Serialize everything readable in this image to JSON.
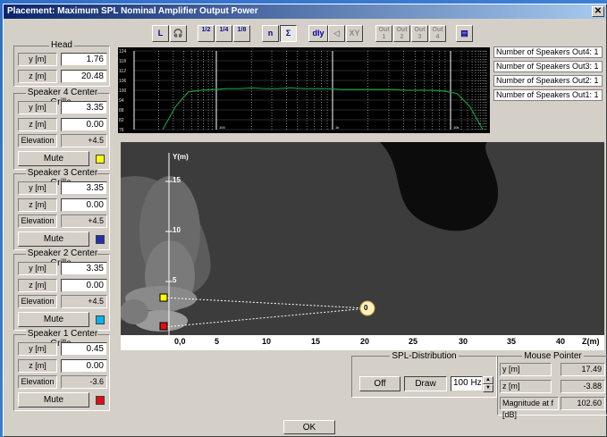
{
  "window": {
    "title": "Placement: Maximum SPL Nominal Amplifier Output Power",
    "close_glyph": "✕"
  },
  "toolbar": {
    "buttons": [
      {
        "label": "L"
      },
      {
        "label": "🎧"
      },
      {
        "label": "1/2"
      },
      {
        "label": "1/4"
      },
      {
        "label": "1/8"
      },
      {
        "label": "n"
      },
      {
        "label": "Σ"
      },
      {
        "label": "dly"
      },
      {
        "label": "◁"
      },
      {
        "label": "XY"
      },
      {
        "label": "Out 1"
      },
      {
        "label": "Out 2"
      },
      {
        "label": "Out 3"
      },
      {
        "label": "Out 4"
      },
      {
        "label": "▤"
      }
    ]
  },
  "head": {
    "title": "Head",
    "y_label": "y [m]",
    "y_value": "1.76",
    "z_label": "z [m]",
    "z_value": "20.48"
  },
  "speakers": [
    {
      "title": "Speaker 4 Center Grille",
      "y_label": "y [m]",
      "y_value": "3.35",
      "z_label": "z [m]",
      "z_value": "0.00",
      "elev_label": "Elevation",
      "elev_value": "+4.5",
      "mute_label": "Mute",
      "color": "#ffff00"
    },
    {
      "title": "Speaker 3 Center Grille",
      "y_label": "y [m]",
      "y_value": "3.35",
      "z_label": "z [m]",
      "z_value": "0.00",
      "elev_label": "Elevation",
      "elev_value": "+4.5",
      "mute_label": "Mute",
      "color": "#2030b0"
    },
    {
      "title": "Speaker 2 Center Grille",
      "y_label": "y [m]",
      "y_value": "3.35",
      "z_label": "z [m]",
      "z_value": "0.00",
      "elev_label": "Elevation",
      "elev_value": "+4.5",
      "mute_label": "Mute",
      "color": "#00b4f0"
    },
    {
      "title": "Speaker 1 Center Grille",
      "y_label": "y [m]",
      "y_value": "0.45",
      "z_label": "z [m]",
      "z_value": "0.00",
      "elev_label": "Elevation",
      "elev_value": "-3.6",
      "mute_label": "Mute",
      "color": "#e01010"
    }
  ],
  "speaker_counts": [
    "Number of Speakers Out4: 1",
    "Number of Speakers Out3: 1",
    "Number of Speakers Out2: 1",
    "Number of Speakers Out1: 1"
  ],
  "spl_distribution": {
    "title": "SPL-Distribution",
    "off_label": "Off",
    "draw_label": "Draw",
    "frequency": "100 Hz"
  },
  "mouse_pointer": {
    "title": "Mouse Pointer",
    "y_label": "y [m]",
    "y_value": "17.49",
    "z_label": "z [m]",
    "z_value": "-3.88",
    "mag_label": "Magnitude at f [dB]",
    "mag_value": "102.60"
  },
  "ok_label": "OK",
  "colors": {
    "spl_curve": "#1a9a3a",
    "field_bg": "#0c0c0c"
  },
  "chart_data": [
    {
      "type": "line",
      "title": "",
      "xlabel": "",
      "ylabel": "",
      "y_ticks": [
        "124",
        "118",
        "112",
        "106",
        "100",
        "94",
        "88",
        "82",
        "76"
      ],
      "ylim": [
        76,
        124
      ],
      "x_tick_labels": [
        "100",
        "1k",
        "10k"
      ],
      "series": [
        {
          "values": [
            76,
            90,
            99,
            100,
            100.5,
            101,
            101,
            101.5,
            101,
            101,
            101.5,
            101,
            101,
            101,
            100.5,
            100.5,
            100.5,
            100.5,
            100.5,
            100,
            100,
            100,
            99.5,
            98,
            90,
            76
          ]
        }
      ],
      "grid": true
    },
    {
      "type": "heatmap",
      "title": "",
      "ylabel": "Y(m)",
      "xlabel": "Z(m)",
      "x_ticks": [
        "0,0",
        "5",
        "10",
        "15",
        "20",
        "25",
        "30",
        "35",
        "40"
      ],
      "y_ticks": [
        "5",
        "10",
        "15"
      ],
      "xlim": [
        0,
        40
      ],
      "ylim": [
        0,
        18
      ],
      "points": [
        {
          "name": "Speaker 4",
          "z": -0.5,
          "y": 3.35,
          "color": "#ffff00"
        },
        {
          "name": "Speaker 1",
          "z": -0.5,
          "y": 0.45,
          "color": "#e01010"
        },
        {
          "name": "Head",
          "z": 20.48,
          "y": 1.76,
          "label": "0"
        }
      ]
    }
  ]
}
